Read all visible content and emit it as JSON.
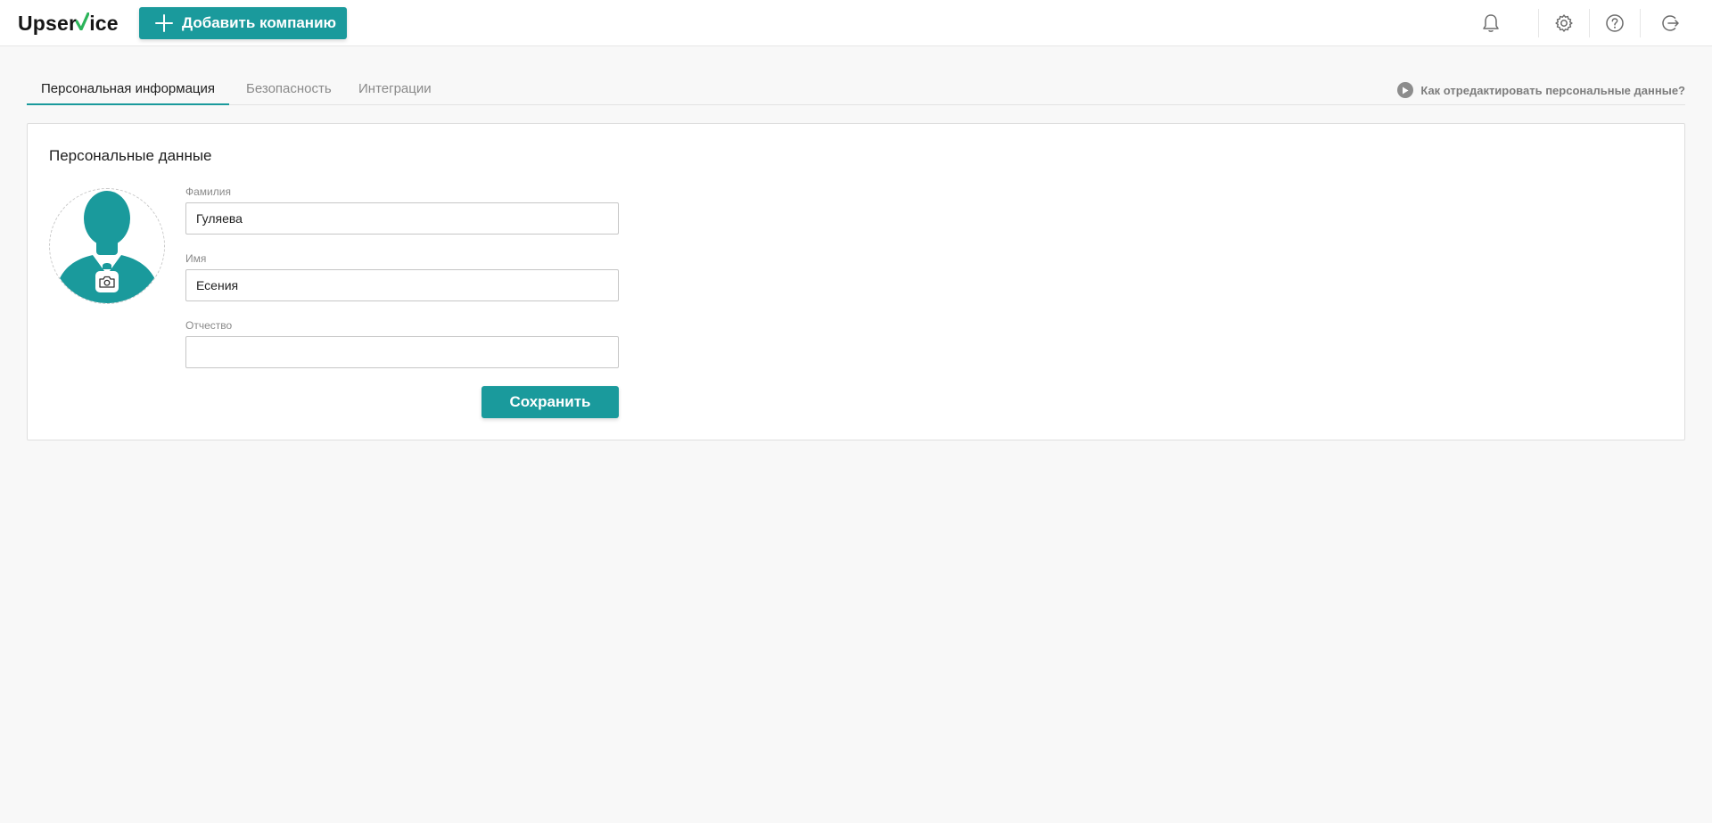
{
  "header": {
    "logo": {
      "before": "Upser",
      "after": "ice"
    },
    "add_company_label": "Добавить компанию",
    "icons": [
      "bell-icon",
      "gear-icon",
      "help-icon",
      "logout-icon"
    ]
  },
  "tabs": [
    {
      "label": "Персональная информация",
      "active": true
    },
    {
      "label": "Безопасность",
      "active": false
    },
    {
      "label": "Интеграции",
      "active": false
    }
  ],
  "help_link": "Как отредактировать персональные данные?",
  "card": {
    "title": "Персональные данные",
    "fields": [
      {
        "label": "Фамилия",
        "value": "Гуляева"
      },
      {
        "label": "Имя",
        "value": "Есения"
      },
      {
        "label": "Отчество",
        "value": ""
      }
    ],
    "save_label": "Сохранить"
  },
  "colors": {
    "accent": "#1a9a9c",
    "logo_check": "#2cb45a",
    "background": "#f8f8f8"
  }
}
